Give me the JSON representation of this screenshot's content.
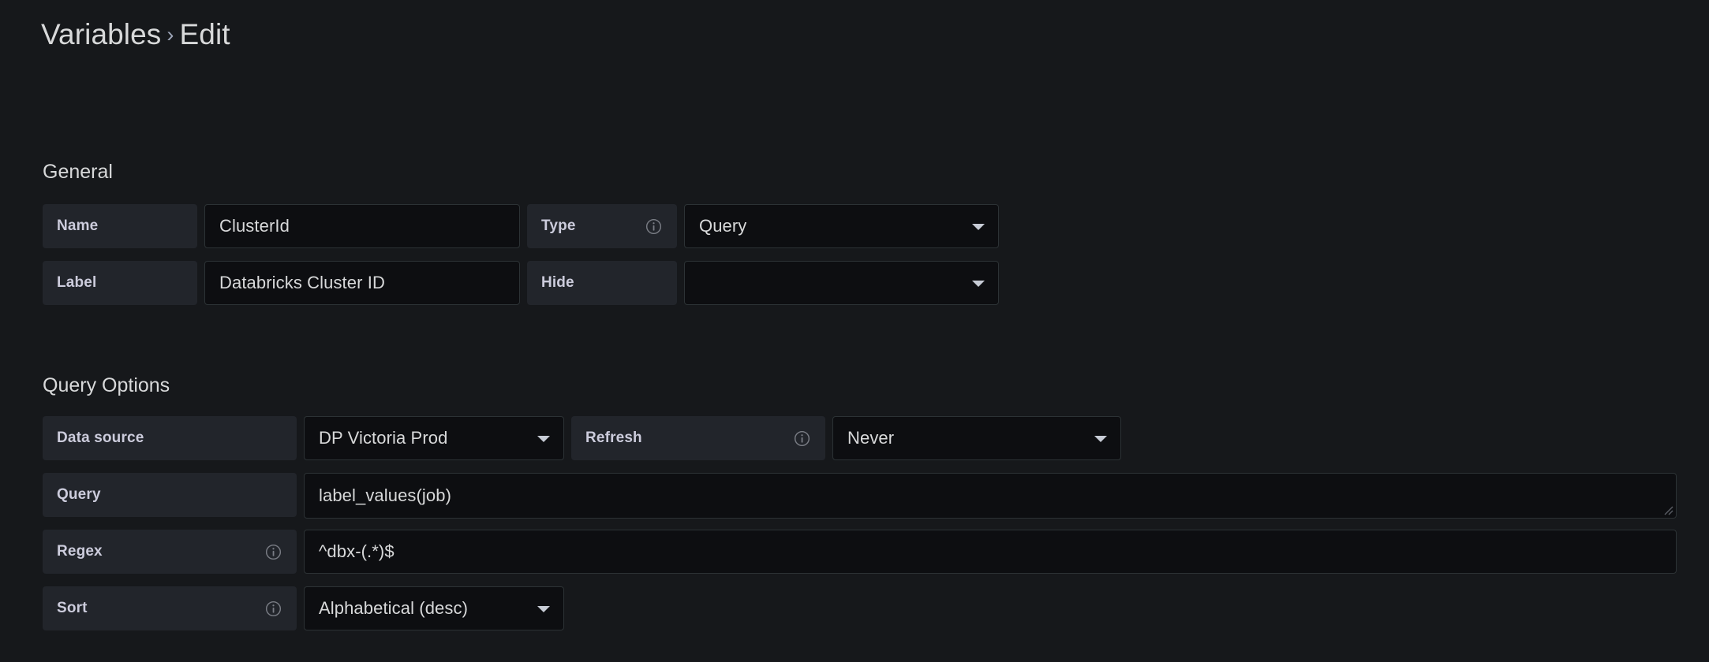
{
  "breadcrumb": {
    "root": "Variables",
    "separator": "›",
    "current": "Edit"
  },
  "sections": {
    "general": {
      "title": "General",
      "fields": {
        "name": {
          "label": "Name",
          "value": "ClusterId"
        },
        "type": {
          "label": "Type",
          "value": "Query",
          "info_icon": "info-circle-icon"
        },
        "label": {
          "label": "Label",
          "value": "Databricks Cluster ID"
        },
        "hide": {
          "label": "Hide",
          "value": ""
        }
      }
    },
    "query_options": {
      "title": "Query Options",
      "fields": {
        "data_source": {
          "label": "Data source",
          "value": "DP Victoria Prod"
        },
        "refresh": {
          "label": "Refresh",
          "value": "Never",
          "info_icon": "info-circle-icon"
        },
        "query": {
          "label": "Query",
          "value": "label_values(job)",
          "resize_handle": "resize-grip-icon"
        },
        "regex": {
          "label": "Regex",
          "value": "^dbx-(.*)$",
          "info_icon": "info-circle-icon"
        },
        "sort": {
          "label": "Sort",
          "value": "Alphabetical (desc)",
          "info_icon": "info-circle-icon"
        }
      }
    }
  },
  "colors": {
    "page_background": "#16181b",
    "label_cell_background": "#22252b",
    "input_background": "#0d0e11",
    "input_border": "#2c3235",
    "text_primary": "#d8d9da",
    "text_label": "#ccccdc",
    "caret": "#c7ccd6"
  }
}
